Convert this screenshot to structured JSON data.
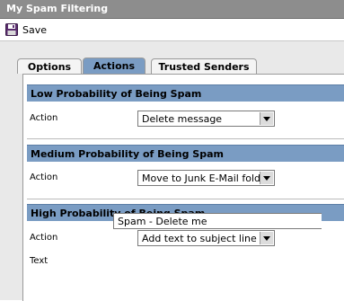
{
  "window": {
    "title": "My Spam Filtering"
  },
  "toolbar": {
    "save_label": "Save",
    "save_icon": "floppy-disk-icon"
  },
  "tabs": [
    {
      "label": "Options",
      "active": false
    },
    {
      "label": "Actions",
      "active": true
    },
    {
      "label": "Trusted Senders",
      "active": false
    }
  ],
  "sections": {
    "low": {
      "title": "Low Probability of Being Spam",
      "action_label": "Action",
      "action_value": "Delete message"
    },
    "medium": {
      "title": "Medium Probability of Being Spam",
      "action_label": "Action",
      "action_value": "Move to Junk E-Mail folder"
    },
    "high": {
      "title": "High Probability of Being Spam",
      "action_label": "Action",
      "action_value": "Add text to subject line",
      "text_label": "Text",
      "text_value": "Spam - Delete me"
    }
  },
  "colors": {
    "title_bar": "#8d8d8d",
    "section_header": "#7a9cc3",
    "tab_active": "#7a9cc3",
    "background": "#e9e9e9"
  }
}
